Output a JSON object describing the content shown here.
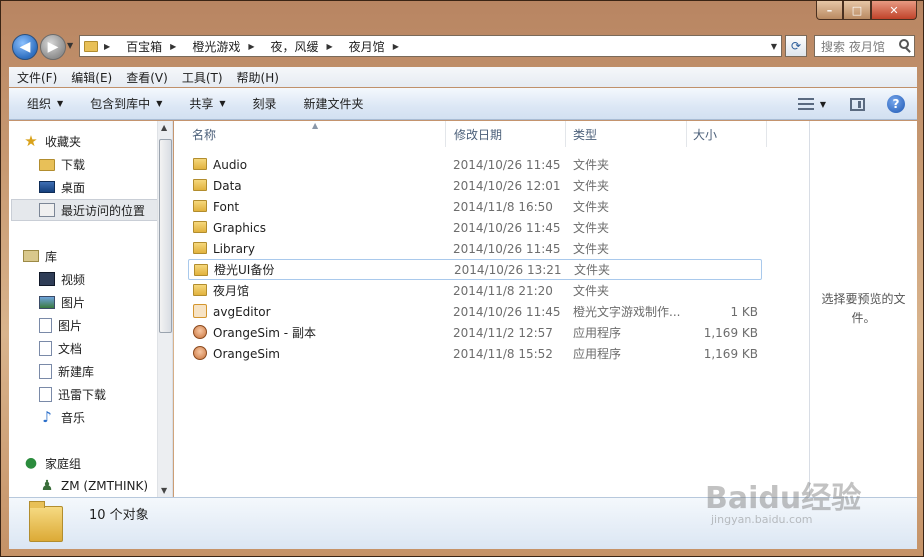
{
  "window": {
    "caption": {
      "minimize": "–",
      "maximize": "□",
      "close": "✕"
    }
  },
  "navigation": {
    "back_icon": "back-arrow-icon",
    "forward_icon": "forward-arrow-icon",
    "breadcrumb": [
      "百宝箱",
      "橙光游戏",
      "夜，风缓",
      "夜月馆"
    ],
    "search_placeholder": "搜索 夜月馆"
  },
  "menu": [
    "文件(F)",
    "编辑(E)",
    "查看(V)",
    "工具(T)",
    "帮助(H)"
  ],
  "commands": [
    {
      "label": "组织",
      "dropdown": true
    },
    {
      "label": "包含到库中",
      "dropdown": true
    },
    {
      "label": "共享",
      "dropdown": true
    },
    {
      "label": "刻录",
      "dropdown": false
    },
    {
      "label": "新建文件夹",
      "dropdown": false
    }
  ],
  "sidebar": {
    "favorites": {
      "label": "收藏夹",
      "items": [
        "下载",
        "桌面",
        "最近访问的位置"
      ]
    },
    "libraries": {
      "label": "库",
      "items": [
        "视频",
        "图片",
        "图片",
        "文档",
        "新建库",
        "迅雷下载",
        "音乐"
      ]
    },
    "homegroup": "家庭组",
    "user": "ZM (ZMTHINK)"
  },
  "columns": {
    "name": "名称",
    "date": "修改日期",
    "type": "类型",
    "size": "大小"
  },
  "files": [
    {
      "name": "Audio",
      "date": "2014/10/26 11:45",
      "type": "文件夹",
      "size": "",
      "icon": "folder-icon"
    },
    {
      "name": "Data",
      "date": "2014/10/26 12:01",
      "type": "文件夹",
      "size": "",
      "icon": "folder-icon"
    },
    {
      "name": "Font",
      "date": "2014/11/8 16:50",
      "type": "文件夹",
      "size": "",
      "icon": "folder-icon"
    },
    {
      "name": "Graphics",
      "date": "2014/10/26 11:45",
      "type": "文件夹",
      "size": "",
      "icon": "folder-icon"
    },
    {
      "name": "Library",
      "date": "2014/10/26 11:45",
      "type": "文件夹",
      "size": "",
      "icon": "folder-icon"
    },
    {
      "name": "橙光UI备份",
      "date": "2014/10/26 13:21",
      "type": "文件夹",
      "size": "",
      "icon": "folder-icon"
    },
    {
      "name": "夜月馆",
      "date": "2014/11/8 21:20",
      "type": "文件夹",
      "size": "",
      "icon": "folder-icon"
    },
    {
      "name": "avgEditor",
      "date": "2014/10/26 11:45",
      "type": "橙光文字游戏制作...",
      "size": "1 KB",
      "icon": "avg-file-icon"
    },
    {
      "name": "OrangeSim - 副本",
      "date": "2014/11/2 12:57",
      "type": "应用程序",
      "size": "1,169 KB",
      "icon": "app-icon"
    },
    {
      "name": "OrangeSim",
      "date": "2014/11/8 15:52",
      "type": "应用程序",
      "size": "1,169 KB",
      "icon": "app-icon"
    }
  ],
  "preview_text": "选择要预览的文件。",
  "status": {
    "count": "10 个对象"
  },
  "watermark": {
    "main": "Baidu经验",
    "sub": "jingyan.baidu.com"
  }
}
